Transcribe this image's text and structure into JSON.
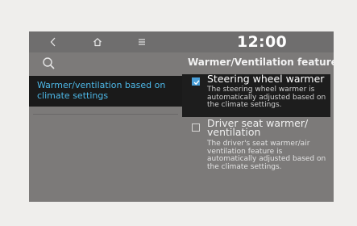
{
  "header": {
    "time": "12:00",
    "title": "Warmer/Ventilation features"
  },
  "icons": {
    "back": "chevron-left-icon",
    "home": "home-icon",
    "menu": "menu-icon",
    "search": "search-icon"
  },
  "sidebar": {
    "items": [
      {
        "label": "Warmer/ventilation based on climate settings",
        "selected": true
      }
    ]
  },
  "options": [
    {
      "title": "Steering wheel warmer",
      "description": "The steering wheel warmer is automatically adjusted based on the climate settings.",
      "checked": true
    },
    {
      "title": "Driver seat warmer/ ventilation",
      "description": "The driver's seat warmer/air ventilation feature is automatically adjusted based on the climate settings.",
      "checked": false
    }
  ],
  "colors": {
    "accent": "#4a9fd8",
    "highlight_text": "#4db8e8",
    "screen_bg": "#7c7a79",
    "selected_bg": "#1d1d1d"
  }
}
